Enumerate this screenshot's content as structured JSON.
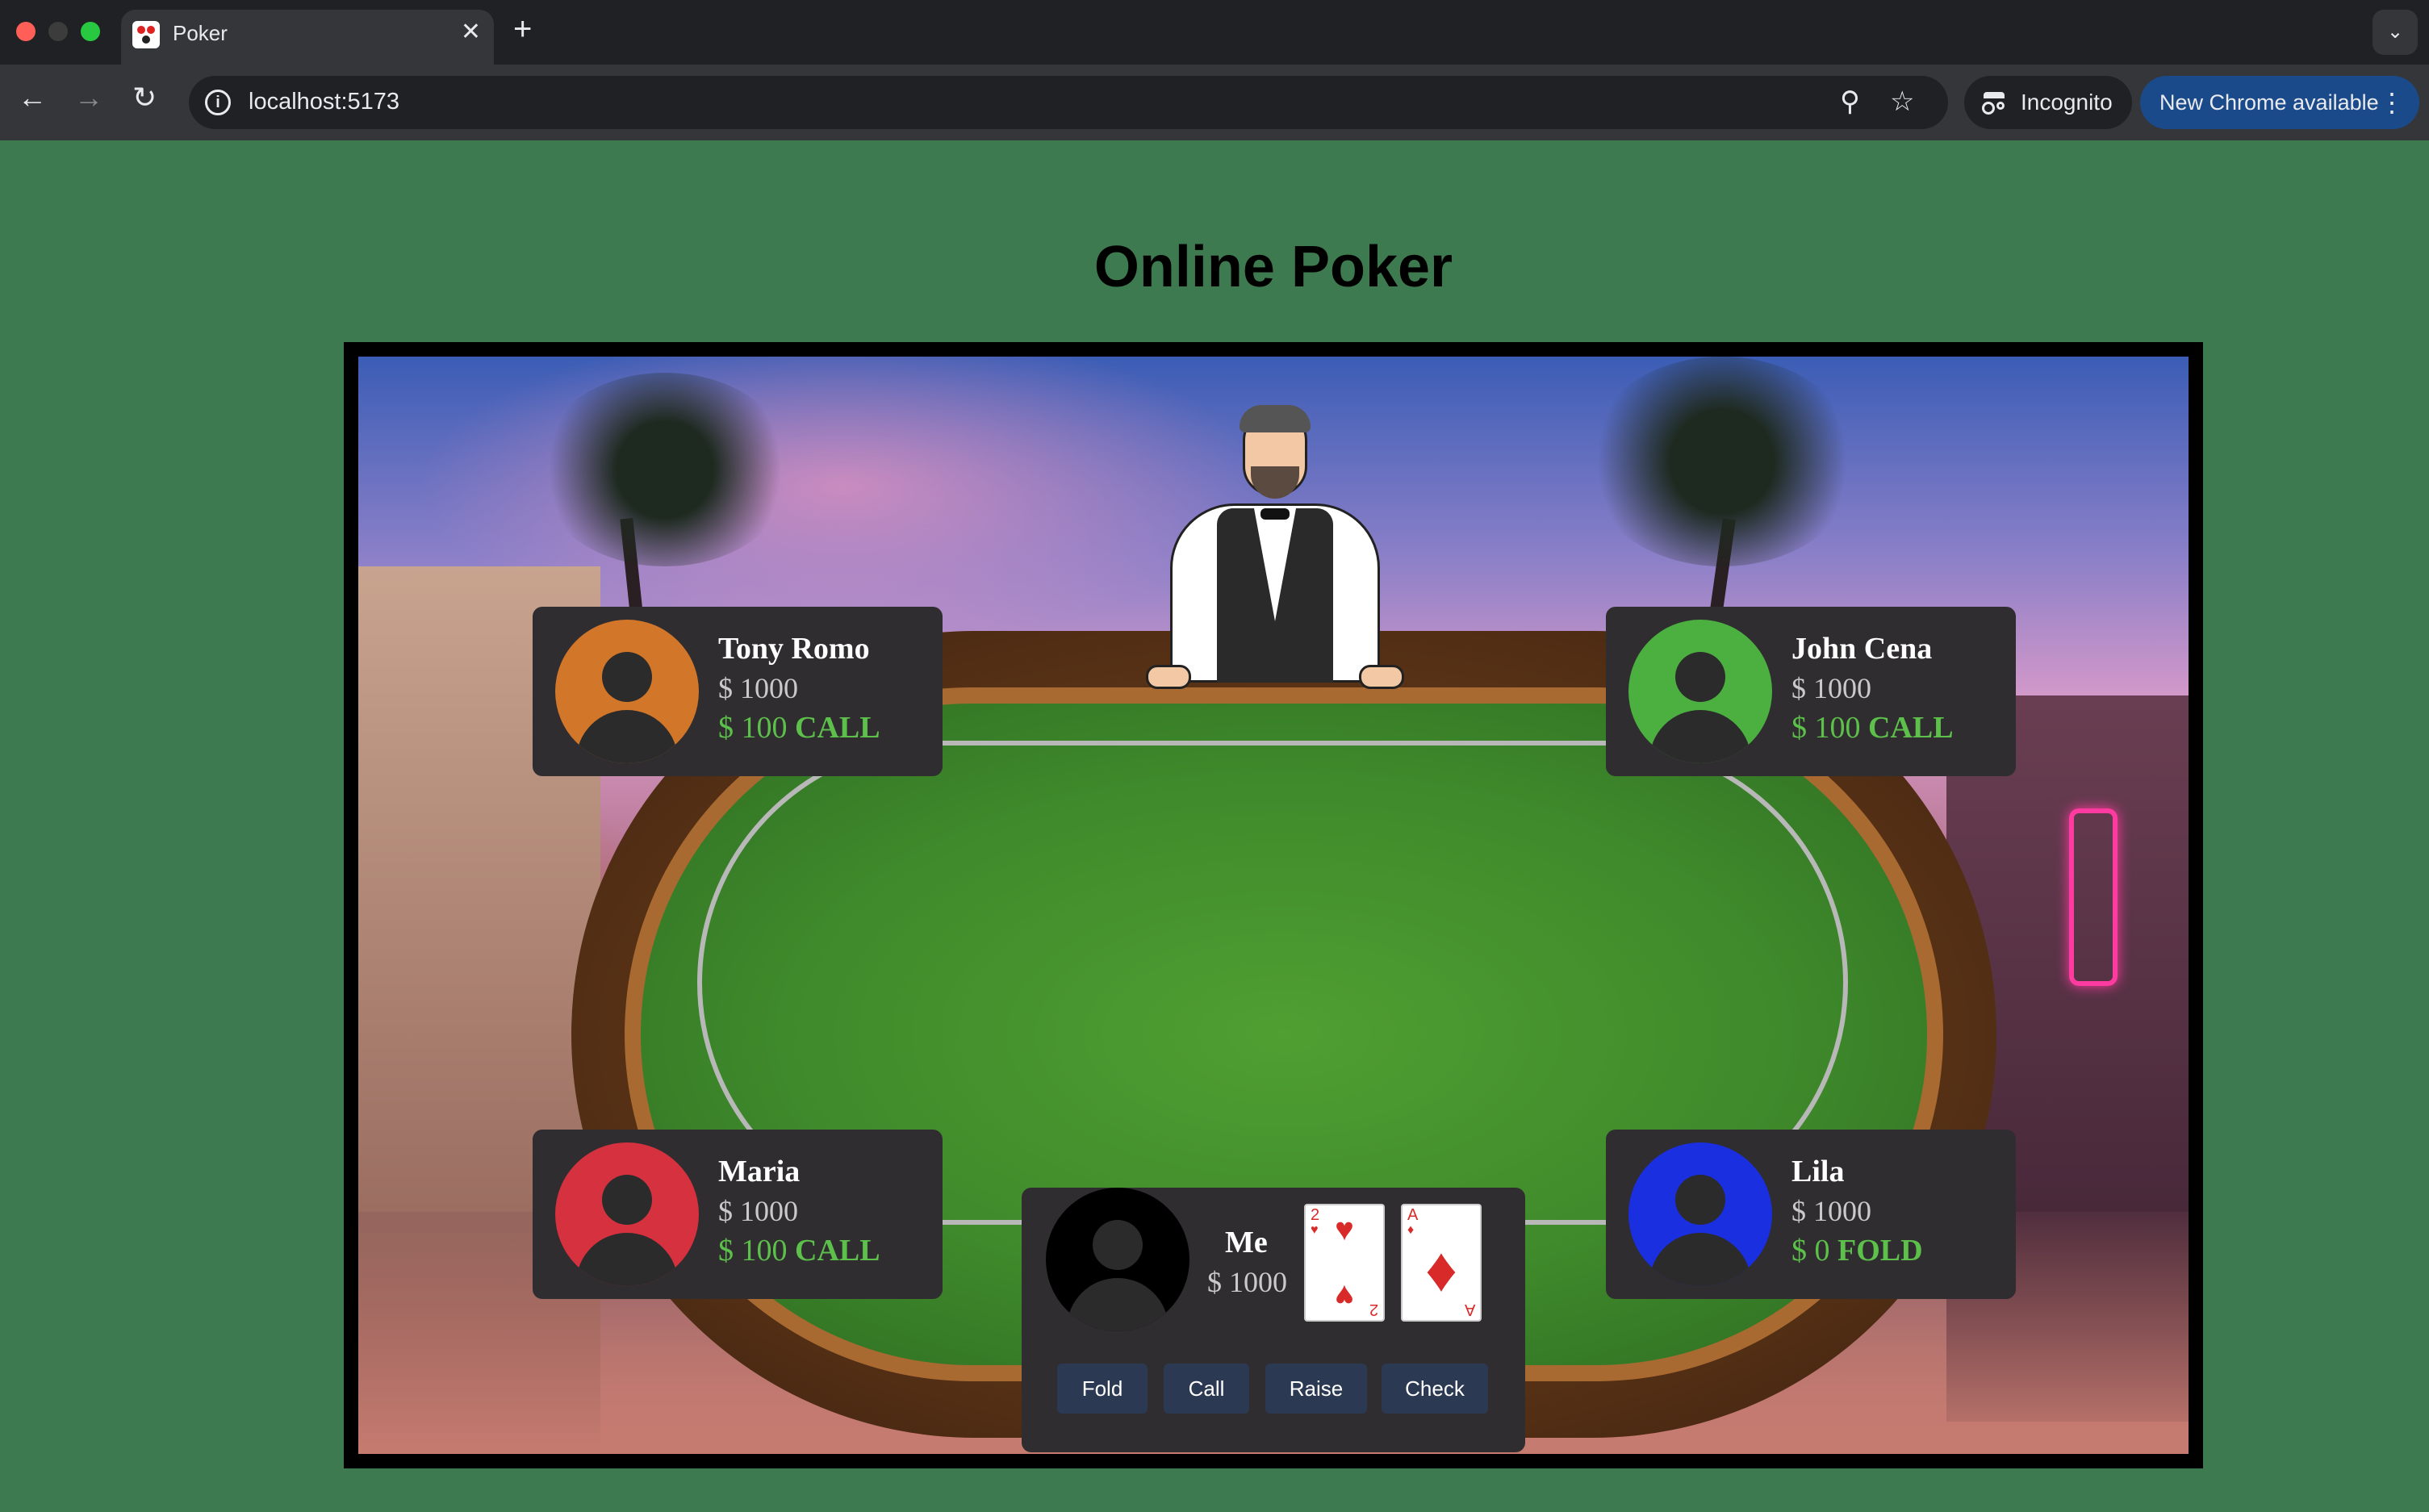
{
  "browser": {
    "tab_title": "Poker",
    "tab_close": "✕",
    "new_tab": "+",
    "url": "localhost:5173",
    "incognito_label": "Incognito",
    "update_label": "New Chrome available",
    "icons": {
      "back": "←",
      "forward": "→",
      "reload": "↻",
      "zoom": "⚲",
      "star": "☆",
      "menu": "⋮",
      "tab_menu": "⌄"
    }
  },
  "page": {
    "title": "Online Poker"
  },
  "players": {
    "tony": {
      "name": "Tony Romo",
      "money": "$ 1000",
      "bet": "$ 100",
      "action": "CALL",
      "avatar_color": "#d2762a"
    },
    "john": {
      "name": "John Cena",
      "money": "$ 1000",
      "bet": "$ 100",
      "action": "CALL",
      "avatar_color": "#4cb040"
    },
    "maria": {
      "name": "Maria",
      "money": "$ 1000",
      "bet": "$ 100",
      "action": "CALL",
      "avatar_color": "#d6313e"
    },
    "lila": {
      "name": "Lila",
      "money": "$ 1000",
      "bet": "$ 0",
      "action": "FOLD",
      "avatar_color": "#1a2fe0"
    }
  },
  "me": {
    "name": "Me",
    "money": "$ 1000",
    "cards": [
      {
        "rank": "2",
        "suit": "♥",
        "color": "#d92a2a"
      },
      {
        "rank": "A",
        "suit": "♦",
        "color": "#d92a2a"
      }
    ]
  },
  "actions": {
    "fold": "Fold",
    "call": "Call",
    "raise": "Raise",
    "check": "Check"
  }
}
